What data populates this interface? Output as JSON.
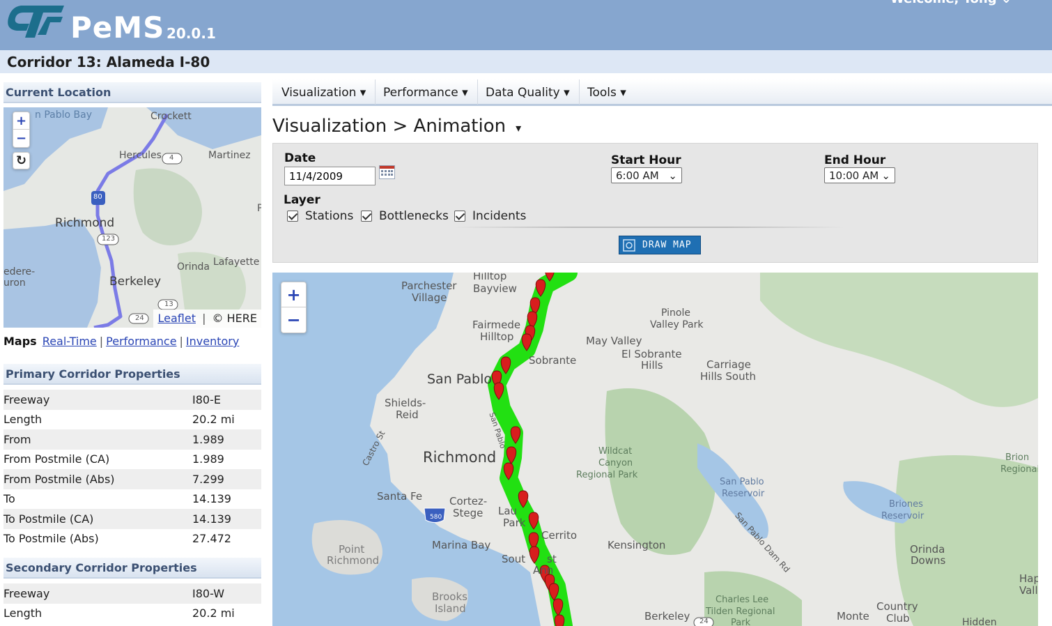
{
  "header": {
    "app_name": "PeMS",
    "version": "20.0.1",
    "welcome": "Welcome, Tong"
  },
  "corridor_title": "Corridor 13: Alameda I-80",
  "current_location": {
    "heading": "Current Location",
    "zoom_in": "+",
    "zoom_out": "−",
    "reset": "↻",
    "attribution_link": "Leaflet",
    "attribution_sep": "|",
    "attribution_text": "© HERE",
    "labels": {
      "san_pablo_bay": "n Pablo Bay",
      "crockett": "Crockett",
      "hercules": "Hercules",
      "martinez": "Martinez",
      "richmond": "Richmond",
      "orinda": "Orinda",
      "lafayette": "Lafayette",
      "berkeley": "Berkeley",
      "belvedere": "edere-",
      "tiburon": "uron",
      "edge_p": "P",
      "shield_4": "4",
      "shield_80": "80",
      "shield_123": "123",
      "shield_13": "13",
      "shield_24": "24"
    }
  },
  "maps_links": {
    "label": "Maps",
    "links": [
      "Real-Time",
      "Performance",
      "Inventory"
    ],
    "sep": "|"
  },
  "primary": {
    "heading": "Primary Corridor Properties",
    "rows": [
      {
        "name": "Freeway",
        "value": "I80-E"
      },
      {
        "name": "Length",
        "value": "20.2 mi"
      },
      {
        "name": "From",
        "value": "1.989"
      },
      {
        "name": "From Postmile (CA)",
        "value": "1.989"
      },
      {
        "name": "From Postmile (Abs)",
        "value": "7.299"
      },
      {
        "name": "To",
        "value": "14.139"
      },
      {
        "name": "To Postmile (CA)",
        "value": "14.139"
      },
      {
        "name": "To Postmile (Abs)",
        "value": "27.472"
      }
    ]
  },
  "secondary": {
    "heading": "Secondary Corridor Properties",
    "rows": [
      {
        "name": "Freeway",
        "value": "I80-W"
      },
      {
        "name": "Length",
        "value": "20.2 mi"
      }
    ]
  },
  "nav": {
    "items": [
      "Visualization ▾",
      "Performance ▾",
      "Data Quality ▾",
      "Tools ▾"
    ]
  },
  "breadcrumb": {
    "text": "Visualization > Animation",
    "caret": "▾"
  },
  "form": {
    "date_label": "Date",
    "date_value": "11/4/2009",
    "start_label": "Start Hour",
    "start_value": "6:00 AM",
    "end_label": "End Hour",
    "end_value": "10:00 AM",
    "layer_label": "Layer",
    "layers": [
      "Stations",
      "Bottlenecks",
      "Incidents"
    ],
    "draw_button": "DRAW MAP"
  },
  "big_map": {
    "zoom_in": "+",
    "zoom_out": "−",
    "route_color": "#22e012",
    "marker_color": "#d81e1e",
    "labels": {
      "hilltop_bayview": "Hilltop\nBayview",
      "parchester": "Parchester",
      "village": "Village",
      "fairmede": "Fairmede",
      "hilltop": "Hilltop",
      "pinole": "Pinole",
      "valley_park": "Valley Park",
      "may_valley": "May Valley",
      "el_sobrante": "El Sobrante",
      "hills": "Hills",
      "sobrante": "Sobrante",
      "carriage": "Carriage",
      "hills_south": "Hills South",
      "san_pablo": "San Pablo",
      "shields": "Shields-",
      "reid": "Reid",
      "castro": "Castro St",
      "san_pablo_road": "San Pablo",
      "richmond": "Richmond",
      "wildcat": "Wildcat",
      "canyon": "Canyon",
      "regional_park": "Regional Park",
      "san_pablo_res": "San Pablo",
      "reservoir": "Reservoir",
      "brion": "Brion",
      "regional": "Regional",
      "santa_fe": "Santa Fe",
      "cortez": "Cortez-",
      "stege": "Stege",
      "laurel": "Lau",
      "park": "Park",
      "cerrito": "Cerrito",
      "briones": "Briones",
      "briones_res": "Reservoir",
      "dam_rd": "San Pablo Dam Rd",
      "point": "Point",
      "point_richmond": "Richmond",
      "marina_bay": "Marina Bay",
      "kensington": "Kensington",
      "south": "Sout",
      "st": "st",
      "ann": "Ann",
      "orinda": "Orinda",
      "downs": "Downs",
      "hap": "Hap",
      "vall": "Vall",
      "brooks": "Brooks",
      "island": "Island",
      "charles_lee": "Charles Lee",
      "tilden": "Tilden Regional",
      "park2": "Park",
      "berkeley": "Berkeley",
      "monte": "Monte",
      "country": "Country",
      "club": "Club",
      "hidden": "Hidden",
      "shield_580": "580",
      "shield_24": "24"
    }
  }
}
